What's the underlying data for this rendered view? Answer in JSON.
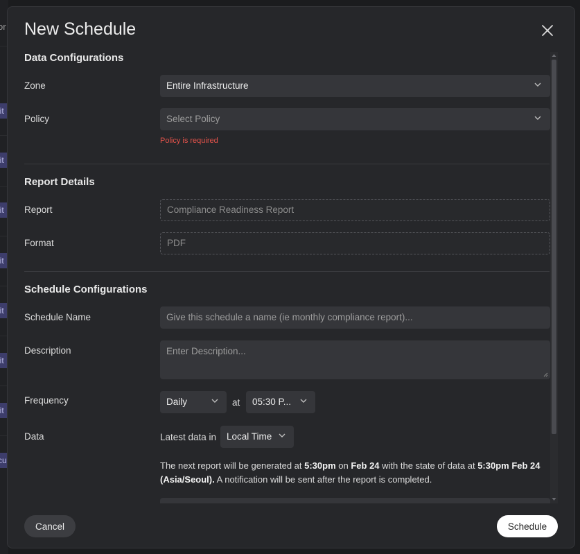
{
  "background": {
    "partial_text": "or",
    "tag_texts": [
      "lit",
      "lit",
      "lit",
      "lit",
      "lit",
      "lit",
      "lit",
      "cu"
    ]
  },
  "modal": {
    "title": "New Schedule",
    "close_icon": "close-icon"
  },
  "data_configurations": {
    "title": "Data Configurations",
    "zone": {
      "label": "Zone",
      "value": "Entire Infrastructure"
    },
    "policy": {
      "label": "Policy",
      "placeholder": "Select Policy",
      "error": "Policy is required"
    }
  },
  "report_details": {
    "title": "Report Details",
    "report": {
      "label": "Report",
      "value": "Compliance Readiness Report"
    },
    "format": {
      "label": "Format",
      "value": "PDF"
    }
  },
  "schedule_configurations": {
    "title": "Schedule Configurations",
    "schedule_name": {
      "label": "Schedule Name",
      "placeholder": "Give this schedule a name (ie monthly compliance report)..."
    },
    "description": {
      "label": "Description",
      "placeholder": "Enter Description..."
    },
    "frequency": {
      "label": "Frequency",
      "value": "Daily",
      "at_text": "at",
      "time": "05:30 P..."
    },
    "data": {
      "label": "Data",
      "prefix": "Latest data in",
      "timezone": "Local Time"
    },
    "info": {
      "part1": "The next report will be generated at ",
      "time1": "5:30pm",
      "part2": " on ",
      "date1": "Feb 24",
      "part3": " with the state of data at ",
      "datetime2": "5:30pm Feb 24 (Asia/Seoul).",
      "part4": " A notification will be sent after the report is completed."
    }
  },
  "footer": {
    "cancel_label": "Cancel",
    "schedule_label": "Schedule"
  },
  "colors": {
    "error": "#e5534b",
    "primary_button": "#ffffff",
    "modal_bg": "#26272a"
  }
}
